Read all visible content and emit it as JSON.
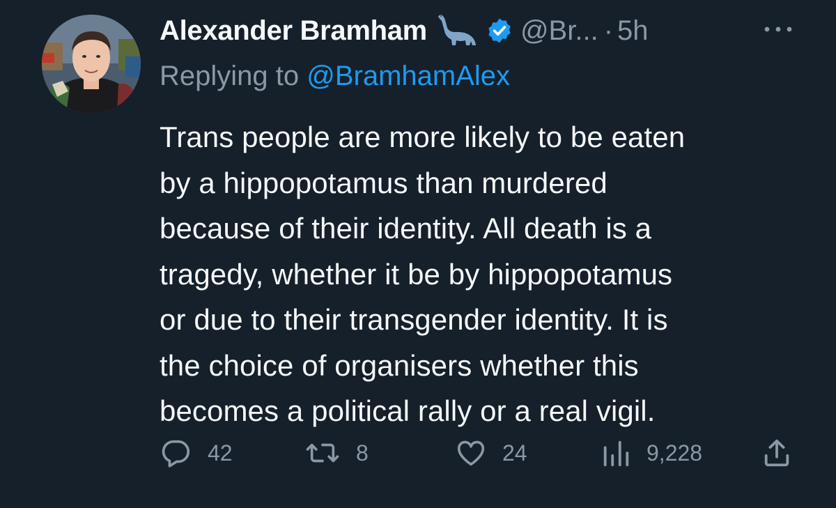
{
  "tweet": {
    "author": {
      "display_name": "Alexander Bramham",
      "name_emoji_icon": "dinosaur-icon",
      "verified_icon": "verified-badge-icon",
      "handle": "@Br...",
      "separator": "·",
      "time": "5h"
    },
    "more_icon": "more-dots-icon",
    "reply": {
      "prefix": "Replying to",
      "mention": "@BramhamAlex"
    },
    "text": "Trans people are more likely to be eaten\nby a hippopotamus than murdered\nbecause of their identity. All death is a\ntragedy, whether it be by hippopotamus\nor due to their transgender identity. It is\nthe choice of organisers whether this\nbecomes a political rally or a real vigil.",
    "actions": {
      "reply": {
        "icon": "comment-icon",
        "count": "42"
      },
      "retweet": {
        "icon": "retweet-icon",
        "count": "8"
      },
      "like": {
        "icon": "heart-icon",
        "count": "24"
      },
      "views": {
        "icon": "views-chart-icon",
        "count": "9,228"
      },
      "share": {
        "icon": "share-icon"
      }
    }
  },
  "colors": {
    "background": "#15202b",
    "text_primary": "#f7f9f9",
    "text_secondary": "#8b98a5",
    "accent": "#1d9bf0"
  }
}
